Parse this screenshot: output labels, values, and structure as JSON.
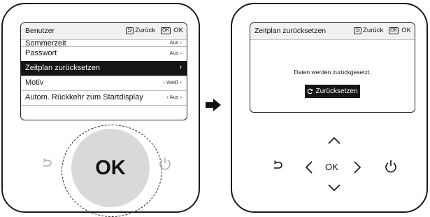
{
  "left_device": {
    "header": {
      "title": "Benutzer",
      "back_label": "Zurück",
      "ok_label": "OK",
      "ok_icon_label": "OK"
    },
    "menu": [
      {
        "label": "Sommerzeit",
        "value": "Aus",
        "selected": false
      },
      {
        "label": "Passwort",
        "value": "Aus",
        "selected": false
      },
      {
        "label": "Zeitplan zurücksetzen",
        "value": "",
        "selected": true
      },
      {
        "label": "Motiv",
        "value": "Weiß",
        "selected": false
      },
      {
        "label": "Autom. Rückkehr zum Startdisplay",
        "value": "Aus",
        "selected": false
      }
    ],
    "ok_button": "OK",
    "back_icon": "back-arrow-icon",
    "power_icon": "power-icon"
  },
  "right_device": {
    "header": {
      "title": "Zeitplan zurücksetzen",
      "back_label": "Zurück",
      "ok_label": "OK",
      "ok_icon_label": "OK"
    },
    "message": "Daten werden zurückgesetzt.",
    "reset_button": "Zurücksetzen",
    "ok_label": "OK"
  },
  "colors": {
    "selected_bg": "#151515",
    "header_bg": "#f1f1f1",
    "ok_circle": "#d9d9d9"
  }
}
